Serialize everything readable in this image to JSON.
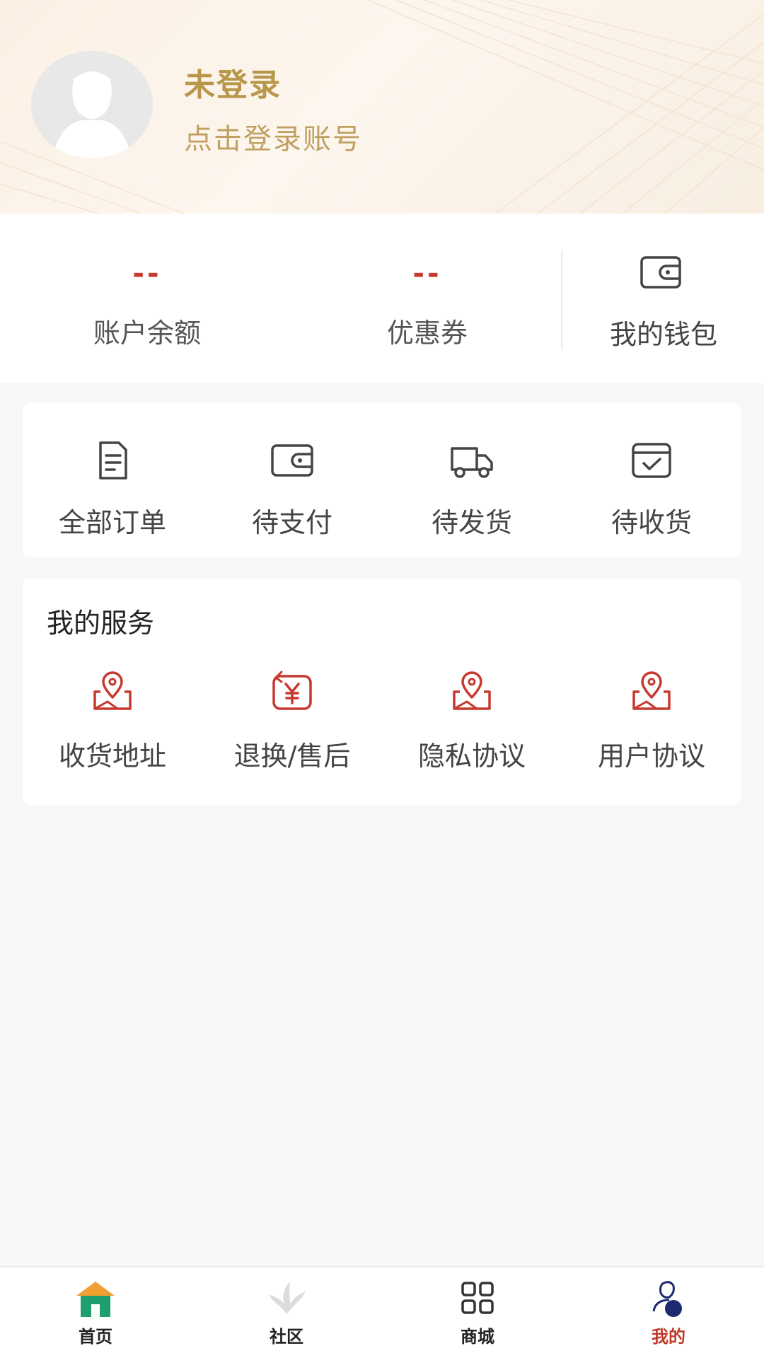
{
  "header": {
    "title": "未登录",
    "subtitle": "点击登录账号",
    "avatar_icon": "user-avatar-icon"
  },
  "account": {
    "balance": {
      "value": "--",
      "label": "账户余额"
    },
    "coupon": {
      "value": "--",
      "label": "优惠券"
    },
    "wallet": {
      "label": "我的钱包",
      "icon": "wallet-icon"
    }
  },
  "orders": [
    {
      "label": "全部订单",
      "icon": "document-icon"
    },
    {
      "label": "待支付",
      "icon": "wallet-icon"
    },
    {
      "label": "待发货",
      "icon": "truck-icon"
    },
    {
      "label": "待收货",
      "icon": "box-check-icon"
    }
  ],
  "services": {
    "title": "我的服务",
    "items": [
      {
        "label": "收货地址",
        "icon": "map-pin-icon"
      },
      {
        "label": "退换/售后",
        "icon": "yen-refund-icon"
      },
      {
        "label": "隐私协议",
        "icon": "map-pin-icon"
      },
      {
        "label": "用户协议",
        "icon": "map-pin-icon"
      }
    ]
  },
  "nav": [
    {
      "label": "首页",
      "icon": "home-icon"
    },
    {
      "label": "社区",
      "icon": "community-icon"
    },
    {
      "label": "商城",
      "icon": "grid-icon"
    },
    {
      "label": "我的",
      "icon": "profile-icon",
      "active": true
    }
  ],
  "colors": {
    "accent_red": "#c7382e",
    "gold": "#b8974a",
    "home_green": "#1f9e6e",
    "home_orange": "#f0a030",
    "profile_navy": "#1d2a6e"
  }
}
